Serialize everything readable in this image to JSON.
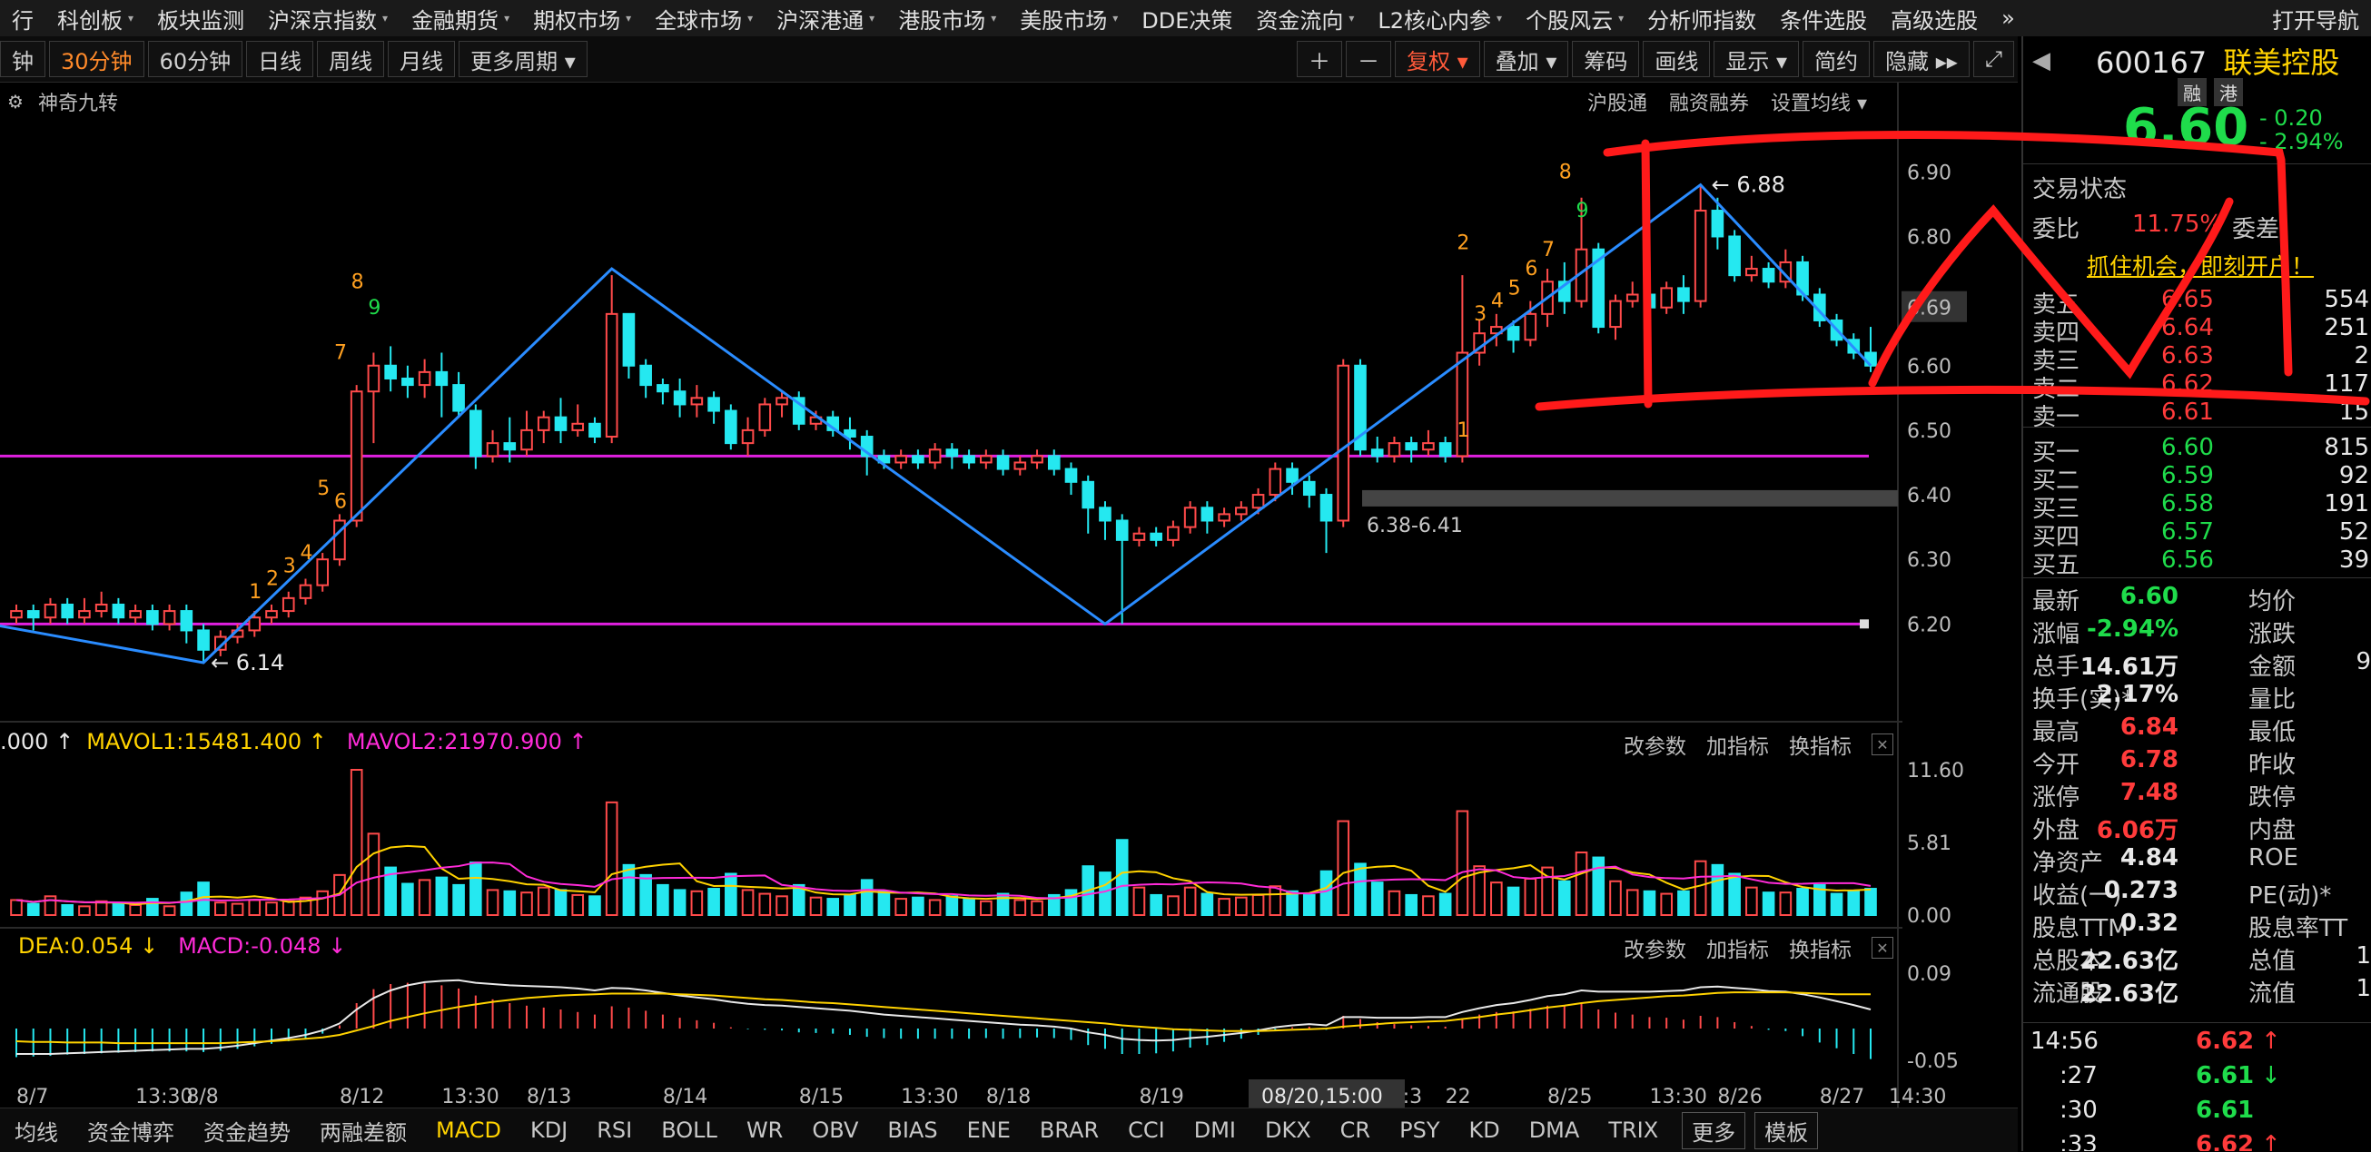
{
  "menu": [
    "行",
    "科创板",
    "板块监测",
    "沪深京指数",
    "金融期货",
    "期权市场",
    "全球市场",
    "沪深港通",
    "港股市场",
    "美股市场",
    "DDE决策",
    "资金流向",
    "L2核心内参",
    "个股风云",
    "分析师指数",
    "条件选股",
    "高级选股",
    "»",
    "打开导航"
  ],
  "menu_arrows": [
    false,
    true,
    false,
    true,
    true,
    true,
    true,
    true,
    true,
    true,
    false,
    true,
    true,
    true,
    false,
    false,
    false,
    false,
    false
  ],
  "toolbar": {
    "periods": [
      "钟",
      "30分钟",
      "60分钟",
      "日线",
      "周线",
      "月线",
      "更多周期 ▾"
    ],
    "active_period": "30分钟",
    "right": [
      "＋",
      "－",
      "复权 ▾",
      "叠加 ▾",
      "筹码",
      "画线",
      "显示 ▾",
      "简约",
      "隐藏 ▸▸",
      "⤢"
    ]
  },
  "indicator_title": "神奇九转",
  "top_links": [
    "沪股通",
    "融资融券",
    "设置均线 ▾"
  ],
  "price_axis": [
    "6.90",
    "6.80",
    "6.69",
    "6.60",
    "6.50",
    "6.40",
    "6.30",
    "6.20"
  ],
  "current_price_tag": "6.69",
  "annotations": {
    "high": "6.88",
    "low": "6.14",
    "zone": "6.38-6.41"
  },
  "seq_counts": {
    "s1": [
      "7",
      "8",
      "9"
    ],
    "s2": [
      "5",
      "6"
    ],
    "s3": [
      "1",
      "2",
      "3",
      "4"
    ],
    "s4": [
      "1"
    ],
    "s5": [
      "2",
      "3",
      "4",
      "5",
      "6",
      "7",
      "8",
      "9"
    ]
  },
  "volume_panel": {
    "label_a": ".000 ↑",
    "mavol1": "MAVOL1:15481.400 ↑",
    "mavol2": "MAVOL2:21970.900 ↑",
    "axis": [
      "11.60",
      "5.81",
      "0.00"
    ]
  },
  "macd_panel": {
    "dea": "DEA:0.054 ↓",
    "macd": "MACD:-0.048 ↓",
    "axis": [
      "0.09",
      "-0.05"
    ]
  },
  "panel_buttons": [
    "改参数",
    "加指标",
    "换指标",
    "✕"
  ],
  "date_axis": [
    "8/7",
    "13:30",
    "8/8",
    "8/12",
    "13:30",
    "8/13",
    "8/14",
    "8/15",
    "13:30",
    "8/18",
    "8/19",
    "8/20",
    "13:3",
    "22",
    "8/25",
    "13:30",
    "8/26",
    "8/27",
    "14:30"
  ],
  "cursor_date": "08/20,15:00",
  "bottom_tabs": [
    "均线",
    "资金博弈",
    "资金趋势",
    "两融差额",
    "MACD",
    "KDJ",
    "RSI",
    "BOLL",
    "WR",
    "OBV",
    "BIAS",
    "ENE",
    "BRAR",
    "CCI",
    "DMI",
    "DKX",
    "CR",
    "PSY",
    "KD",
    "DMA",
    "TRIX",
    "更多",
    "模板"
  ],
  "active_bottom_tab": "MACD",
  "stock": {
    "code": "600167",
    "name": "联美控股",
    "tags": [
      "融",
      "港"
    ],
    "price": "6.60",
    "change": "- 0.20",
    "pct": "- 2.94%",
    "status_label": "交易状态",
    "weibi_label": "委比",
    "weibi": "11.75%",
    "weicha_label": "委差",
    "banner": "抓住机会，即刻开户！"
  },
  "order_book": {
    "asks": [
      {
        "label": "卖五",
        "price": "6.65",
        "vol": "554"
      },
      {
        "label": "卖四",
        "price": "6.64",
        "vol": "251"
      },
      {
        "label": "卖三",
        "price": "6.63",
        "vol": "2"
      },
      {
        "label": "卖二",
        "price": "6.62",
        "vol": "117"
      },
      {
        "label": "卖一",
        "price": "6.61",
        "vol": "15"
      }
    ],
    "bids": [
      {
        "label": "买一",
        "price": "6.60",
        "vol": "815"
      },
      {
        "label": "买二",
        "price": "6.59",
        "vol": "92"
      },
      {
        "label": "买三",
        "price": "6.58",
        "vol": "191"
      },
      {
        "label": "买四",
        "price": "6.57",
        "vol": "52"
      },
      {
        "label": "买五",
        "price": "6.56",
        "vol": "39"
      }
    ]
  },
  "stats": [
    {
      "k": "最新",
      "v": "6.60",
      "c": "green",
      "k2": "均价",
      "v2": ""
    },
    {
      "k": "涨幅",
      "v": "-2.94%",
      "c": "green",
      "k2": "涨跌",
      "v2": ""
    },
    {
      "k": "总手",
      "v": "14.61万",
      "c": "white",
      "k2": "金额",
      "v2": "9"
    },
    {
      "k": "换手(实)*",
      "v": "2.17%",
      "c": "white",
      "k2": "量比",
      "v2": ""
    },
    {
      "k": "最高",
      "v": "6.84",
      "c": "red",
      "k2": "最低",
      "v2": ""
    },
    {
      "k": "今开",
      "v": "6.78",
      "c": "red",
      "k2": "昨收",
      "v2": ""
    },
    {
      "k": "涨停",
      "v": "7.48",
      "c": "red",
      "k2": "跌停",
      "v2": ""
    },
    {
      "k": "外盘",
      "v": "6.06万",
      "c": "red",
      "k2": "内盘",
      "v2": ""
    },
    {
      "k": "净资产",
      "v": "4.84",
      "c": "white",
      "k2": "ROE",
      "v2": ""
    },
    {
      "k": "收益(一)",
      "v": "0.273",
      "c": "white",
      "k2": "PE(动)*",
      "v2": ""
    },
    {
      "k": "股息TTM",
      "v": "0.32",
      "c": "white",
      "k2": "股息率TT",
      "v2": ""
    },
    {
      "k": "总股本",
      "v": "22.63亿",
      "c": "white",
      "k2": "总值",
      "v2": "1"
    },
    {
      "k": "流通股",
      "v": "22.63亿",
      "c": "white",
      "k2": "流值",
      "v2": "1"
    }
  ],
  "ticks": [
    {
      "t": "14:56",
      "p": "6.62",
      "a": "↑",
      "c": "red"
    },
    {
      "t": ":27",
      "p": "6.61",
      "a": "↓",
      "c": "green"
    },
    {
      "t": ":30",
      "p": "6.61",
      "a": "",
      "c": "green"
    },
    {
      "t": ":33",
      "p": "6.62",
      "a": "↑",
      "c": "red"
    }
  ],
  "chart_data": {
    "type": "candlestick",
    "timeframe": "30分钟",
    "ylim": [
      6.14,
      6.93
    ],
    "candles": [
      [
        6.21,
        6.22,
        6.2,
        6.23
      ],
      [
        6.22,
        6.21,
        6.19,
        6.23
      ],
      [
        6.21,
        6.23,
        6.2,
        6.24
      ],
      [
        6.23,
        6.21,
        6.2,
        6.24
      ],
      [
        6.21,
        6.22,
        6.2,
        6.24
      ],
      [
        6.22,
        6.23,
        6.21,
        6.25
      ],
      [
        6.23,
        6.21,
        6.2,
        6.24
      ],
      [
        6.21,
        6.22,
        6.2,
        6.23
      ],
      [
        6.22,
        6.2,
        6.19,
        6.23
      ],
      [
        6.2,
        6.22,
        6.19,
        6.23
      ],
      [
        6.22,
        6.19,
        6.17,
        6.23
      ],
      [
        6.19,
        6.16,
        6.14,
        6.2
      ],
      [
        6.16,
        6.18,
        6.15,
        6.19
      ],
      [
        6.18,
        6.19,
        6.17,
        6.2
      ],
      [
        6.19,
        6.21,
        6.18,
        6.22
      ],
      [
        6.21,
        6.22,
        6.2,
        6.23
      ],
      [
        6.22,
        6.24,
        6.21,
        6.25
      ],
      [
        6.24,
        6.26,
        6.23,
        6.27
      ],
      [
        6.26,
        6.3,
        6.25,
        6.31
      ],
      [
        6.3,
        6.36,
        6.29,
        6.37
      ],
      [
        6.36,
        6.56,
        6.35,
        6.57
      ],
      [
        6.56,
        6.6,
        6.48,
        6.62
      ],
      [
        6.6,
        6.58,
        6.56,
        6.63
      ],
      [
        6.58,
        6.57,
        6.55,
        6.6
      ],
      [
        6.57,
        6.59,
        6.55,
        6.61
      ],
      [
        6.59,
        6.57,
        6.52,
        6.62
      ],
      [
        6.57,
        6.53,
        6.52,
        6.59
      ],
      [
        6.53,
        6.46,
        6.44,
        6.54
      ],
      [
        6.46,
        6.48,
        6.45,
        6.5
      ],
      [
        6.48,
        6.47,
        6.45,
        6.52
      ],
      [
        6.47,
        6.5,
        6.46,
        6.53
      ],
      [
        6.5,
        6.52,
        6.48,
        6.53
      ],
      [
        6.52,
        6.5,
        6.48,
        6.55
      ],
      [
        6.5,
        6.51,
        6.49,
        6.54
      ],
      [
        6.51,
        6.49,
        6.48,
        6.52
      ],
      [
        6.49,
        6.68,
        6.48,
        6.74
      ],
      [
        6.68,
        6.6,
        6.58,
        6.68
      ],
      [
        6.6,
        6.57,
        6.55,
        6.61
      ],
      [
        6.57,
        6.56,
        6.54,
        6.58
      ],
      [
        6.56,
        6.54,
        6.52,
        6.58
      ],
      [
        6.54,
        6.55,
        6.52,
        6.57
      ],
      [
        6.55,
        6.53,
        6.51,
        6.56
      ],
      [
        6.53,
        6.48,
        6.47,
        6.54
      ],
      [
        6.48,
        6.5,
        6.46,
        6.52
      ],
      [
        6.5,
        6.54,
        6.49,
        6.55
      ],
      [
        6.54,
        6.55,
        6.52,
        6.56
      ],
      [
        6.55,
        6.51,
        6.5,
        6.56
      ],
      [
        6.51,
        6.52,
        6.5,
        6.53
      ],
      [
        6.52,
        6.5,
        6.49,
        6.53
      ],
      [
        6.5,
        6.49,
        6.47,
        6.52
      ],
      [
        6.49,
        6.46,
        6.43,
        6.5
      ],
      [
        6.46,
        6.45,
        6.44,
        6.47
      ],
      [
        6.45,
        6.46,
        6.44,
        6.47
      ],
      [
        6.46,
        6.45,
        6.44,
        6.47
      ],
      [
        6.45,
        6.47,
        6.44,
        6.48
      ],
      [
        6.47,
        6.46,
        6.44,
        6.48
      ],
      [
        6.46,
        6.45,
        6.44,
        6.47
      ],
      [
        6.45,
        6.46,
        6.44,
        6.47
      ],
      [
        6.46,
        6.44,
        6.43,
        6.47
      ],
      [
        6.44,
        6.45,
        6.43,
        6.46
      ],
      [
        6.45,
        6.46,
        6.44,
        6.47
      ],
      [
        6.46,
        6.44,
        6.43,
        6.47
      ],
      [
        6.44,
        6.42,
        6.4,
        6.45
      ],
      [
        6.42,
        6.38,
        6.34,
        6.43
      ],
      [
        6.38,
        6.36,
        6.33,
        6.39
      ],
      [
        6.36,
        6.33,
        6.2,
        6.37
      ],
      [
        6.33,
        6.34,
        6.32,
        6.35
      ],
      [
        6.34,
        6.33,
        6.32,
        6.35
      ],
      [
        6.33,
        6.35,
        6.32,
        6.36
      ],
      [
        6.35,
        6.38,
        6.34,
        6.39
      ],
      [
        6.38,
        6.36,
        6.34,
        6.39
      ],
      [
        6.36,
        6.37,
        6.35,
        6.38
      ],
      [
        6.37,
        6.38,
        6.36,
        6.39
      ],
      [
        6.38,
        6.4,
        6.37,
        6.41
      ],
      [
        6.4,
        6.44,
        6.39,
        6.45
      ],
      [
        6.44,
        6.42,
        6.4,
        6.45
      ],
      [
        6.42,
        6.4,
        6.38,
        6.43
      ],
      [
        6.4,
        6.36,
        6.31,
        6.41
      ],
      [
        6.36,
        6.6,
        6.35,
        6.61
      ],
      [
        6.6,
        6.47,
        6.46,
        6.61
      ],
      [
        6.47,
        6.46,
        6.45,
        6.49
      ],
      [
        6.46,
        6.48,
        6.45,
        6.49
      ],
      [
        6.48,
        6.47,
        6.45,
        6.49
      ],
      [
        6.47,
        6.48,
        6.46,
        6.5
      ],
      [
        6.48,
        6.46,
        6.45,
        6.49
      ],
      [
        6.46,
        6.62,
        6.45,
        6.74
      ],
      [
        6.62,
        6.65,
        6.6,
        6.67
      ],
      [
        6.65,
        6.66,
        6.63,
        6.68
      ],
      [
        6.66,
        6.64,
        6.62,
        6.67
      ],
      [
        6.64,
        6.68,
        6.63,
        6.7
      ],
      [
        6.68,
        6.73,
        6.66,
        6.75
      ],
      [
        6.73,
        6.7,
        6.68,
        6.76
      ],
      [
        6.7,
        6.78,
        6.69,
        6.86
      ],
      [
        6.78,
        6.66,
        6.65,
        6.79
      ],
      [
        6.66,
        6.7,
        6.64,
        6.71
      ],
      [
        6.7,
        6.71,
        6.69,
        6.73
      ],
      [
        6.71,
        6.69,
        6.68,
        6.72
      ],
      [
        6.69,
        6.72,
        6.68,
        6.73
      ],
      [
        6.72,
        6.7,
        6.68,
        6.74
      ],
      [
        6.7,
        6.84,
        6.69,
        6.88
      ],
      [
        6.84,
        6.8,
        6.78,
        6.86
      ],
      [
        6.8,
        6.74,
        6.73,
        6.81
      ],
      [
        6.74,
        6.75,
        6.73,
        6.77
      ],
      [
        6.75,
        6.73,
        6.72,
        6.76
      ],
      [
        6.73,
        6.76,
        6.72,
        6.78
      ],
      [
        6.76,
        6.71,
        6.7,
        6.77
      ],
      [
        6.71,
        6.67,
        6.66,
        6.72
      ],
      [
        6.67,
        6.64,
        6.63,
        6.68
      ],
      [
        6.64,
        6.62,
        6.61,
        6.65
      ],
      [
        6.62,
        6.6,
        6.59,
        6.66
      ]
    ],
    "volume": [
      1.2,
      0.9,
      1.5,
      0.8,
      0.7,
      1.1,
      0.9,
      0.8,
      1.3,
      0.7,
      1.8,
      2.6,
      1.0,
      0.9,
      1.2,
      1.0,
      1.1,
      1.4,
      1.9,
      3.2,
      11.6,
      6.5,
      3.8,
      2.5,
      2.8,
      3.0,
      2.4,
      4.2,
      2.0,
      1.9,
      1.8,
      2.2,
      2.0,
      1.6,
      1.5,
      9.0,
      4.0,
      3.2,
      2.4,
      2.0,
      1.9,
      2.1,
      3.3,
      2.0,
      1.7,
      1.5,
      2.4,
      1.4,
      1.3,
      1.6,
      2.8,
      1.9,
      1.3,
      1.4,
      1.2,
      1.5,
      1.3,
      1.1,
      1.7,
      1.2,
      1.1,
      1.6,
      2.0,
      3.9,
      3.4,
      6.0,
      2.2,
      1.6,
      1.5,
      2.2,
      1.7,
      1.3,
      1.4,
      1.6,
      2.3,
      1.9,
      1.6,
      3.5,
      7.5,
      4.1,
      2.6,
      1.9,
      1.6,
      1.5,
      1.7,
      8.3,
      3.9,
      2.6,
      2.2,
      2.9,
      3.8,
      2.7,
      5.0,
      4.6,
      2.7,
      2.0,
      1.9,
      1.7,
      1.9,
      4.3,
      4.0,
      3.3,
      2.2,
      1.8,
      1.8,
      2.1,
      2.4,
      1.7,
      1.9,
      2.1
    ],
    "macd": [
      -0.045,
      -0.044,
      -0.043,
      -0.041,
      -0.04,
      -0.039,
      -0.038,
      -0.037,
      -0.036,
      -0.036,
      -0.036,
      -0.037,
      -0.035,
      -0.032,
      -0.028,
      -0.024,
      -0.02,
      -0.015,
      -0.008,
      0.005,
      0.04,
      0.062,
      0.07,
      0.072,
      0.071,
      0.068,
      0.063,
      0.052,
      0.046,
      0.04,
      0.036,
      0.033,
      0.03,
      0.026,
      0.022,
      0.035,
      0.033,
      0.028,
      0.022,
      0.017,
      0.013,
      0.009,
      0.002,
      -0.001,
      -0.002,
      -0.003,
      -0.006,
      -0.007,
      -0.008,
      -0.01,
      -0.013,
      -0.015,
      -0.016,
      -0.016,
      -0.016,
      -0.016,
      -0.016,
      -0.015,
      -0.016,
      -0.015,
      -0.014,
      -0.015,
      -0.018,
      -0.026,
      -0.032,
      -0.04,
      -0.04,
      -0.039,
      -0.036,
      -0.03,
      -0.026,
      -0.021,
      -0.016,
      -0.01,
      -0.002,
      0.002,
      0.003,
      -0.002,
      0.02,
      0.015,
      0.01,
      0.007,
      0.005,
      0.004,
      0.003,
      0.016,
      0.022,
      0.026,
      0.027,
      0.031,
      0.036,
      0.036,
      0.04,
      0.03,
      0.025,
      0.022,
      0.018,
      0.017,
      0.014,
      0.02,
      0.018,
      0.01,
      0.004,
      -0.002,
      -0.004,
      -0.012,
      -0.022,
      -0.031,
      -0.04,
      -0.048
    ],
    "dif": [
      -0.04,
      -0.04,
      -0.04,
      -0.039,
      -0.038,
      -0.037,
      -0.036,
      -0.035,
      -0.034,
      -0.033,
      -0.032,
      -0.032,
      -0.03,
      -0.027,
      -0.023,
      -0.019,
      -0.015,
      -0.01,
      -0.003,
      0.008,
      0.03,
      0.048,
      0.06,
      0.068,
      0.073,
      0.075,
      0.076,
      0.072,
      0.07,
      0.068,
      0.067,
      0.066,
      0.065,
      0.063,
      0.06,
      0.064,
      0.063,
      0.06,
      0.056,
      0.052,
      0.049,
      0.046,
      0.042,
      0.039,
      0.037,
      0.036,
      0.034,
      0.032,
      0.03,
      0.028,
      0.025,
      0.022,
      0.02,
      0.018,
      0.016,
      0.014,
      0.012,
      0.01,
      0.008,
      0.006,
      0.005,
      0.003,
      0.0,
      -0.006,
      -0.01,
      -0.016,
      -0.018,
      -0.019,
      -0.018,
      -0.015,
      -0.013,
      -0.01,
      -0.007,
      -0.003,
      0.002,
      0.005,
      0.007,
      0.005,
      0.018,
      0.018,
      0.017,
      0.017,
      0.017,
      0.018,
      0.018,
      0.026,
      0.032,
      0.037,
      0.04,
      0.045,
      0.051,
      0.054,
      0.06,
      0.058,
      0.058,
      0.058,
      0.058,
      0.059,
      0.06,
      0.065,
      0.066,
      0.064,
      0.062,
      0.059,
      0.058,
      0.054,
      0.049,
      0.043,
      0.037,
      0.03
    ],
    "dea": [
      -0.02,
      -0.021,
      -0.021,
      -0.022,
      -0.022,
      -0.022,
      -0.023,
      -0.023,
      -0.023,
      -0.023,
      -0.023,
      -0.023,
      -0.023,
      -0.022,
      -0.021,
      -0.02,
      -0.018,
      -0.016,
      -0.014,
      -0.01,
      -0.003,
      0.004,
      0.012,
      0.018,
      0.024,
      0.029,
      0.034,
      0.038,
      0.042,
      0.045,
      0.048,
      0.05,
      0.052,
      0.053,
      0.054,
      0.055,
      0.055,
      0.055,
      0.055,
      0.054,
      0.053,
      0.052,
      0.05,
      0.048,
      0.046,
      0.045,
      0.043,
      0.041,
      0.04,
      0.038,
      0.036,
      0.034,
      0.032,
      0.03,
      0.028,
      0.026,
      0.024,
      0.022,
      0.02,
      0.018,
      0.016,
      0.014,
      0.012,
      0.01,
      0.008,
      0.005,
      0.003,
      0.001,
      -0.001,
      -0.002,
      -0.003,
      -0.004,
      -0.004,
      -0.004,
      -0.003,
      -0.002,
      -0.001,
      0.0,
      0.003,
      0.005,
      0.007,
      0.009,
      0.01,
      0.011,
      0.012,
      0.015,
      0.018,
      0.022,
      0.025,
      0.029,
      0.033,
      0.036,
      0.04,
      0.043,
      0.045,
      0.047,
      0.049,
      0.051,
      0.052,
      0.054,
      0.056,
      0.057,
      0.057,
      0.057,
      0.057,
      0.056,
      0.055,
      0.054,
      0.054,
      0.054
    ]
  }
}
